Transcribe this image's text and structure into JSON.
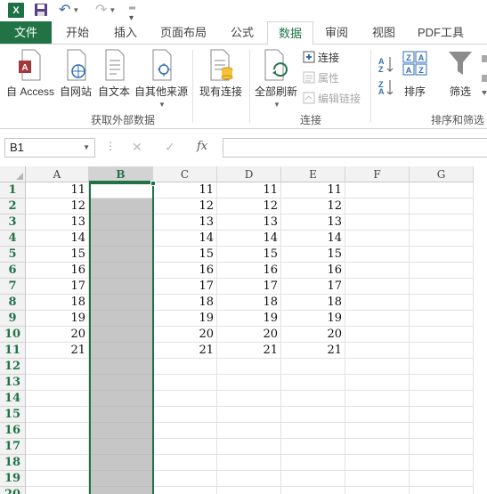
{
  "qat": {
    "app_logo": "X",
    "icons": [
      "excel-logo-icon",
      "save-icon",
      "undo-icon",
      "redo-icon",
      "customize-icon"
    ]
  },
  "tabs": [
    {
      "label": "文件",
      "state": "file"
    },
    {
      "label": "开始",
      "state": ""
    },
    {
      "label": "插入",
      "state": ""
    },
    {
      "label": "页面布局",
      "state": ""
    },
    {
      "label": "公式",
      "state": ""
    },
    {
      "label": "数据",
      "state": "active"
    },
    {
      "label": "审阅",
      "state": ""
    },
    {
      "label": "视图",
      "state": ""
    },
    {
      "label": "PDF工具",
      "state": ""
    }
  ],
  "ribbon": {
    "get_external": {
      "access": "自 Access",
      "web": "自网站",
      "text": "自文本",
      "other": "自其他来源",
      "existing": "现有连接",
      "group_label": "获取外部数据"
    },
    "connections": {
      "refresh_all": "全部刷新",
      "connections": "连接",
      "properties": "属性",
      "edit_links": "编辑链接",
      "group_label": "连接"
    },
    "sort_filter": {
      "sort": "排序",
      "filter": "筛选",
      "group_label": "排序和筛选"
    }
  },
  "formula_bar": {
    "name_box": "B1",
    "fx": "fx",
    "value": ""
  },
  "colors": {
    "accent": "#217346",
    "selected_column": "#c6c6c6"
  },
  "grid": {
    "columns": [
      "A",
      "B",
      "C",
      "D",
      "E",
      "F",
      "G"
    ],
    "selected_column": "B",
    "rows": [
      {
        "n": "1",
        "A": "11",
        "B": "",
        "C": "11",
        "D": "11",
        "E": "11"
      },
      {
        "n": "2",
        "A": "12",
        "B": "",
        "C": "12",
        "D": "12",
        "E": "12"
      },
      {
        "n": "3",
        "A": "13",
        "B": "",
        "C": "13",
        "D": "13",
        "E": "13"
      },
      {
        "n": "4",
        "A": "14",
        "B": "",
        "C": "14",
        "D": "14",
        "E": "14"
      },
      {
        "n": "5",
        "A": "15",
        "B": "",
        "C": "15",
        "D": "15",
        "E": "15"
      },
      {
        "n": "6",
        "A": "16",
        "B": "",
        "C": "16",
        "D": "16",
        "E": "16"
      },
      {
        "n": "7",
        "A": "17",
        "B": "",
        "C": "17",
        "D": "17",
        "E": "17"
      },
      {
        "n": "8",
        "A": "18",
        "B": "",
        "C": "18",
        "D": "18",
        "E": "18"
      },
      {
        "n": "9",
        "A": "19",
        "B": "",
        "C": "19",
        "D": "19",
        "E": "19"
      },
      {
        "n": "10",
        "A": "20",
        "B": "",
        "C": "20",
        "D": "20",
        "E": "20"
      },
      {
        "n": "11",
        "A": "21",
        "B": "",
        "C": "21",
        "D": "21",
        "E": "21"
      },
      {
        "n": "12",
        "A": "",
        "B": "",
        "C": "",
        "D": "",
        "E": ""
      },
      {
        "n": "13",
        "A": "",
        "B": "",
        "C": "",
        "D": "",
        "E": ""
      },
      {
        "n": "14",
        "A": "",
        "B": "",
        "C": "",
        "D": "",
        "E": ""
      },
      {
        "n": "15",
        "A": "",
        "B": "",
        "C": "",
        "D": "",
        "E": ""
      },
      {
        "n": "16",
        "A": "",
        "B": "",
        "C": "",
        "D": "",
        "E": ""
      },
      {
        "n": "17",
        "A": "",
        "B": "",
        "C": "",
        "D": "",
        "E": ""
      },
      {
        "n": "18",
        "A": "",
        "B": "",
        "C": "",
        "D": "",
        "E": ""
      },
      {
        "n": "19",
        "A": "",
        "B": "",
        "C": "",
        "D": "",
        "E": ""
      },
      {
        "n": "20",
        "A": "",
        "B": "",
        "C": "",
        "D": "",
        "E": ""
      }
    ]
  }
}
